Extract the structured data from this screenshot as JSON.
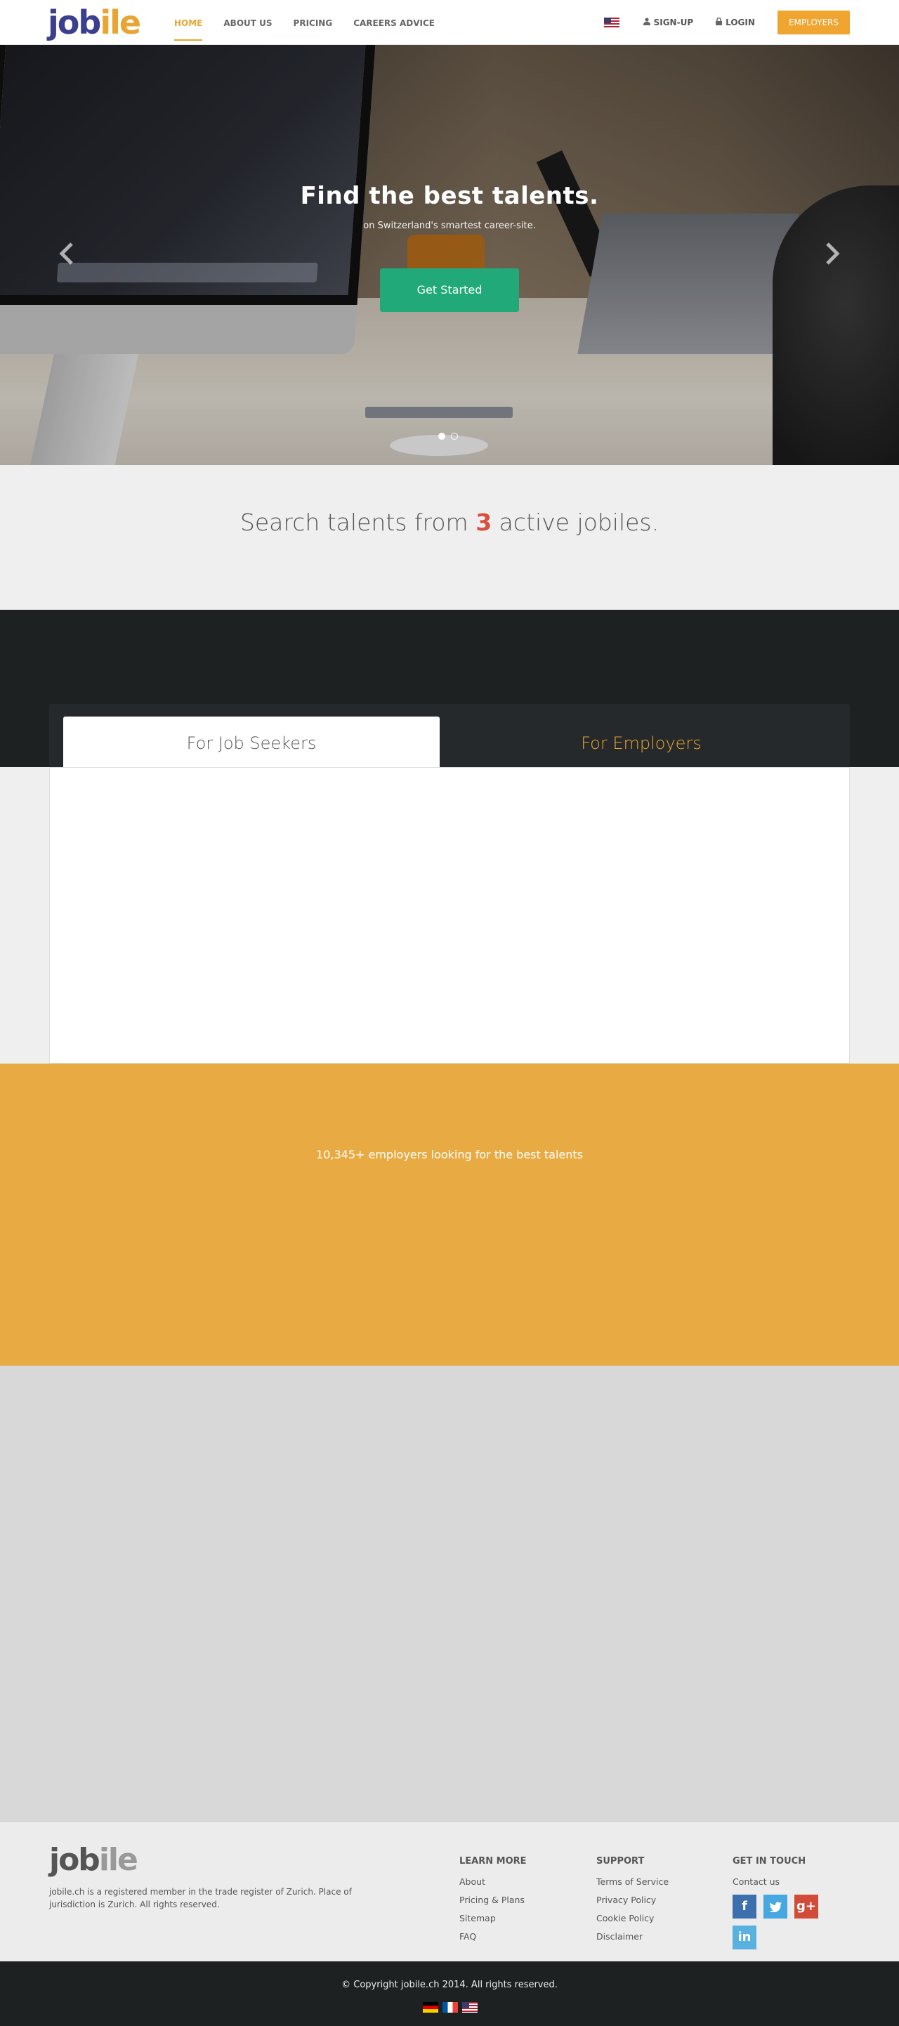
{
  "brand": {
    "logo_part1": "job",
    "logo_part2": "ile"
  },
  "nav": {
    "links": [
      {
        "label": "HOME"
      },
      {
        "label": "ABOUT US"
      },
      {
        "label": "PRICING"
      },
      {
        "label": "CAREERS ADVICE"
      }
    ],
    "signup_label": "SIGN-UP",
    "login_label": "LOGIN",
    "employers_label": "EMPLOYERS"
  },
  "hero": {
    "title": "Find the best talents.",
    "subtitle": "on Switzerland's smartest career-site.",
    "cta_label": "Get Started",
    "slides": 2,
    "active_slide": 1
  },
  "search": {
    "prefix": "Search talents from",
    "count": "3",
    "suffix": "active jobiles."
  },
  "tabs": {
    "seekers_label": "For Job Seekers",
    "employers_label": "For Employers"
  },
  "employers_band": {
    "text": "10,345+ employers looking for the best talents"
  },
  "footer": {
    "description": "jobile.ch is a registered member in the trade register of Zurich. Place of jurisdiction is Zurich. All rights reserved.",
    "learn_more": {
      "title": "LEARN MORE",
      "links": [
        "About",
        "Pricing & Plans",
        "Sitemap",
        "FAQ"
      ]
    },
    "support": {
      "title": "SUPPORT",
      "links": [
        "Terms of Service",
        "Privacy Policy",
        "Cookie Policy",
        "Disclaimer"
      ]
    },
    "get_in_touch": {
      "title": "GET IN TOUCH",
      "contact_label": "Contact us",
      "socials": [
        {
          "glyph": "f",
          "icon": "facebook-icon",
          "color": "#3b6fae"
        },
        {
          "glyph": "t",
          "icon": "twitter-icon",
          "color": "#47a7e1"
        },
        {
          "glyph": "g+",
          "icon": "google-plus-icon",
          "color": "#d24a38"
        },
        {
          "glyph": "in",
          "icon": "linkedin-icon",
          "color": "#58b1df"
        }
      ]
    },
    "copyright": "© Copyright jobile.ch 2014. All rights reserved."
  },
  "colors": {
    "accent": "#e8a531",
    "brand_blue": "#3b3f8f",
    "cta_green": "#21a97a",
    "highlight_red": "#d9503f"
  }
}
